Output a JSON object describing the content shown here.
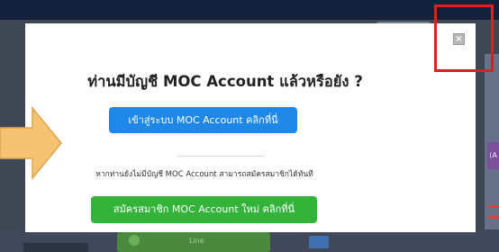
{
  "modal": {
    "title": "ท่านมีบัญชี MOC Account แล้วหรือยัง ?",
    "login_button": "เข้าสู่ระบบ MOC Account คลิกที่นี่",
    "hint": "หากท่านยังไม่มีบัญชี MOC Account สามารถสมัครสมาชิกได้ทันที",
    "register_button": "สมัครสมาชิก MOC Account ใหม่ คลิกที่นี่",
    "close_glyph": "×"
  },
  "background": {
    "line_label": "Line",
    "side_badge": "(A"
  },
  "colors": {
    "login_button": "#1f87e8",
    "register_button": "#33b339",
    "highlight": "#e01e1e",
    "arrow": "#f5c271"
  },
  "icons": [
    "close-icon",
    "arrow-right-icon",
    "line-icon"
  ]
}
